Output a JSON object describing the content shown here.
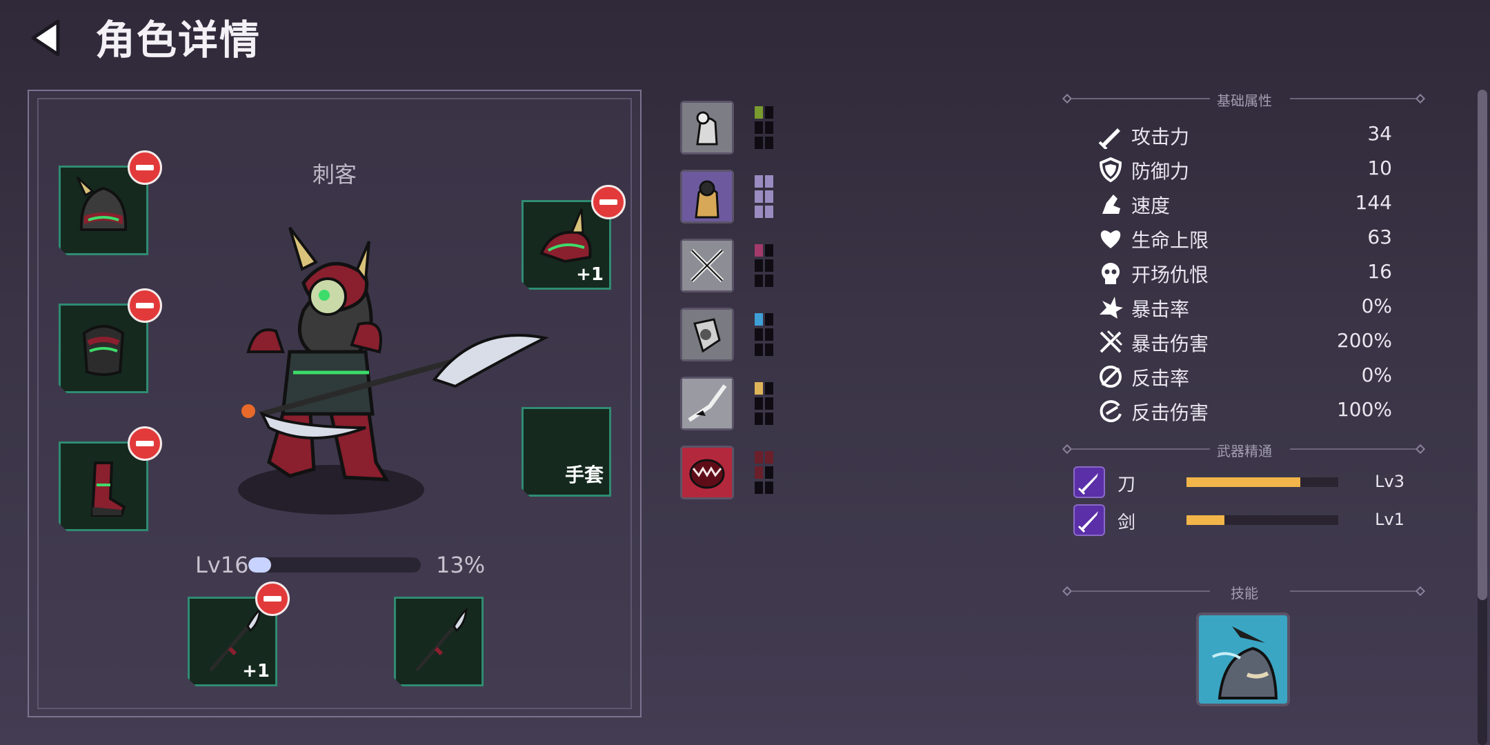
{
  "header": {
    "title": "角色详情"
  },
  "character": {
    "class_name": "刺客",
    "level_label": "Lv16",
    "exp_percent": 13,
    "exp_text": "13%"
  },
  "equipment": {
    "left_slots": [
      {
        "name": "helmet"
      },
      {
        "name": "armor"
      },
      {
        "name": "boots"
      }
    ],
    "right_slots": [
      {
        "name": "shoulder",
        "plus": "+1"
      },
      {
        "name": "gloves",
        "label": "手套"
      }
    ],
    "weapon_slots": [
      {
        "name": "main-weapon",
        "plus": "+1"
      },
      {
        "name": "off-weapon"
      }
    ]
  },
  "skill_cards": [
    {
      "icon": "fist-icon",
      "pip_color": "#7a9b2e",
      "pips_filled": 1
    },
    {
      "icon": "warrior-icon",
      "pip_color": "#9a8cc0",
      "pips_filled": 6
    },
    {
      "icon": "crossed-swords-icon",
      "pip_color": "#a33a6a",
      "pips_filled": 1
    },
    {
      "icon": "shield-fist-icon",
      "pip_color": "#3fa0d8",
      "pips_filled": 1
    },
    {
      "icon": "hand-strike-icon",
      "pip_color": "#e0b55a",
      "pips_filled": 1
    },
    {
      "icon": "monster-mouth-icon",
      "pip_color": "#6a1f2a",
      "pips_filled": 3
    }
  ],
  "sections": {
    "basic": "基础属性",
    "weapon_mastery": "武器精通",
    "skills": "技能"
  },
  "stats": [
    {
      "icon": "sword-icon",
      "label": "攻击力",
      "value": "34"
    },
    {
      "icon": "shield-icon",
      "label": "防御力",
      "value": "10"
    },
    {
      "icon": "boot-icon",
      "label": "速度",
      "value": "144"
    },
    {
      "icon": "heart-icon",
      "label": "生命上限",
      "value": "63"
    },
    {
      "icon": "skull-icon",
      "label": "开场仇恨",
      "value": "16"
    },
    {
      "icon": "crit-icon",
      "label": "暴击率",
      "value": "0%"
    },
    {
      "icon": "crit-damage-icon",
      "label": "暴击伤害",
      "value": "200%"
    },
    {
      "icon": "counter-icon",
      "label": "反击率",
      "value": "0%"
    },
    {
      "icon": "counter-damage-icon",
      "label": "反击伤害",
      "value": "100%"
    }
  ],
  "weapon_mastery": [
    {
      "icon": "blade-icon",
      "label": "刀",
      "progress": 0.75,
      "level": "Lv3"
    },
    {
      "icon": "sword-mastery-icon",
      "label": "剑",
      "progress": 0.25,
      "level": "Lv1"
    }
  ]
}
